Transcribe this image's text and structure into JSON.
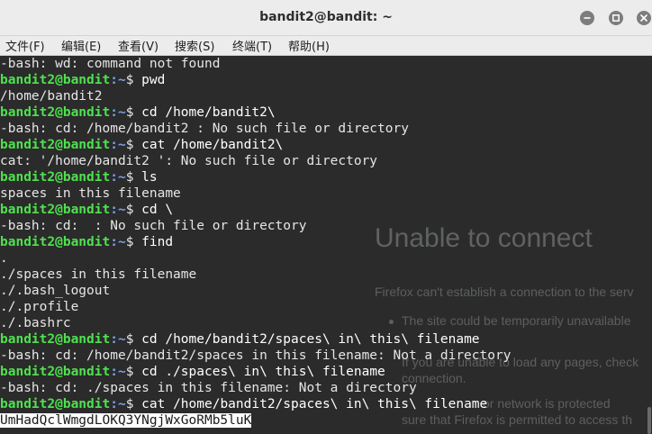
{
  "window": {
    "title": "bandit2@bandit: ~"
  },
  "menu": [
    {
      "label": "文件(F)"
    },
    {
      "label": "编辑(E)"
    },
    {
      "label": "查看(V)"
    },
    {
      "label": "搜索(S)"
    },
    {
      "label": "终端(T)"
    },
    {
      "label": "帮助(H)"
    }
  ],
  "prompt": {
    "userhost": "bandit2@bandit",
    "dir": ":~",
    "sign": "$ "
  },
  "terminal_lines": [
    {
      "kind": "out",
      "text": "-bash: wd: command not found"
    },
    {
      "kind": "cmd",
      "text": "pwd"
    },
    {
      "kind": "out",
      "text": "/home/bandit2"
    },
    {
      "kind": "cmd",
      "text": "cd /home/bandit2\\"
    },
    {
      "kind": "out",
      "text": "-bash: cd: /home/bandit2 : No such file or directory"
    },
    {
      "kind": "cmd",
      "text": "cat /home/bandit2\\"
    },
    {
      "kind": "out",
      "text": "cat: '/home/bandit2 ': No such file or directory"
    },
    {
      "kind": "cmd",
      "text": "ls"
    },
    {
      "kind": "out",
      "text": "spaces in this filename"
    },
    {
      "kind": "cmd",
      "text": "cd \\"
    },
    {
      "kind": "out",
      "text": "-bash: cd:  : No such file or directory"
    },
    {
      "kind": "cmd",
      "text": "find"
    },
    {
      "kind": "out",
      "text": "."
    },
    {
      "kind": "out",
      "text": "./spaces in this filename"
    },
    {
      "kind": "out",
      "text": "./.bash_logout"
    },
    {
      "kind": "out",
      "text": "./.profile"
    },
    {
      "kind": "out",
      "text": "./.bashrc"
    },
    {
      "kind": "cmd",
      "text": "cd /home/bandit2/spaces\\ in\\ this\\ filename"
    },
    {
      "kind": "out",
      "text": "-bash: cd: /home/bandit2/spaces in this filename: Not a directory"
    },
    {
      "kind": "cmd",
      "text": "cd ./spaces\\ in\\ this\\ filename"
    },
    {
      "kind": "out",
      "text": "-bash: cd: ./spaces in this filename: Not a directory"
    },
    {
      "kind": "cmd",
      "text": "cat /home/bandit2/spaces\\ in\\ this\\ filename"
    },
    {
      "kind": "sel",
      "text": "UmHadQclWmgdLOKQ3YNgjWxGoRMb5luK"
    }
  ],
  "background_window": {
    "title": "Unable to connect",
    "subtitle": "Firefox can't establish a connection to the serv",
    "bullet1": "The site could be temporarily unavailable",
    "bullet2a": "If you are unable to load any pages, check",
    "bullet2b": "connection.",
    "bullet3a": "or network is protected",
    "bullet3b": "sure that Firefox is permitted to access th"
  }
}
